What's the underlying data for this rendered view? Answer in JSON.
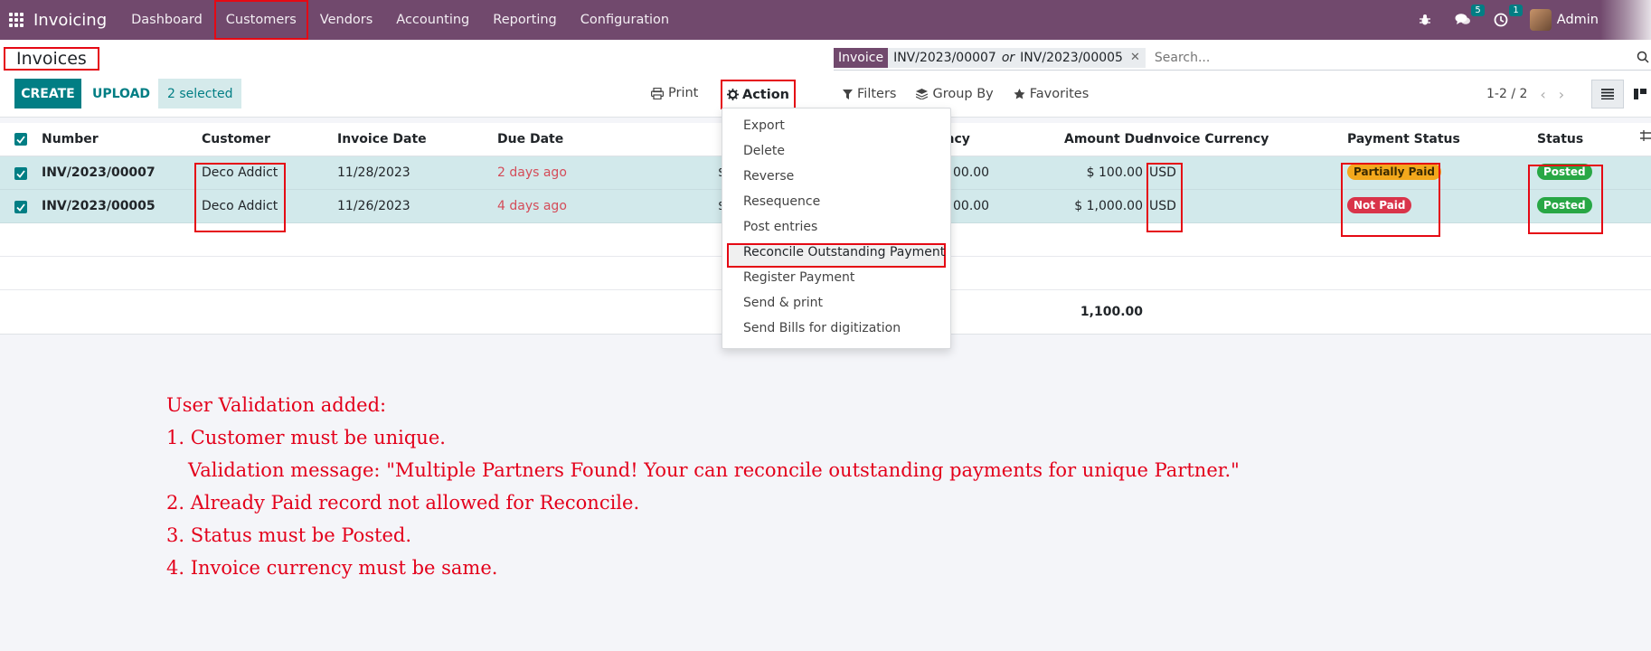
{
  "navbar": {
    "app_name": "Invoicing",
    "menu": [
      "Dashboard",
      "Customers",
      "Vendors",
      "Accounting",
      "Reporting",
      "Configuration"
    ],
    "highlighted_menu": "Customers",
    "messages_count": "5",
    "activities_count": "1",
    "user_name": "Admin",
    "bg_color": "#71496d"
  },
  "control_panel": {
    "title": "Invoices",
    "create_label": "CREATE",
    "upload_label": "UPLOAD",
    "selected_label": "2 selected",
    "print_label": "Print",
    "action_label": "Action",
    "search": {
      "facet_label": "Invoice",
      "facet_value_1": "INV/2023/00007",
      "facet_or": "or",
      "facet_value_2": "INV/2023/00005",
      "placeholder": "Search..."
    },
    "filters_label": "Filters",
    "group_by_label": "Group By",
    "favorites_label": "Favorites",
    "pager": "1-2 / 2"
  },
  "table": {
    "columns": {
      "number": "Number",
      "customer": "Customer",
      "invoice_date": "Invoice Date",
      "due_date": "Due Date",
      "currency_partial": "ency",
      "amount_due": "Amount Due",
      "invoice_currency": "Invoice Currency",
      "payment_status": "Payment Status",
      "status": "Status"
    },
    "rows": [
      {
        "number": "INV/2023/00007",
        "customer": "Deco Addict",
        "invoice_date": "11/28/2023",
        "due_date": "2 days ago",
        "total_partial": "$",
        "tax_excl_partial": "00.00",
        "amount_due": "$ 100.00",
        "currency": "USD",
        "payment_status": "Partially Paid",
        "status": "Posted"
      },
      {
        "number": "INV/2023/00005",
        "customer": "Deco Addict",
        "invoice_date": "11/26/2023",
        "due_date": "4 days ago",
        "total_partial": "$",
        "tax_excl_partial": "00.00",
        "amount_due": "$ 1,000.00",
        "currency": "USD",
        "payment_status": "Not Paid",
        "status": "Posted"
      }
    ],
    "total_amount_due": "1,100.00"
  },
  "action_menu": {
    "items": [
      "Export",
      "Delete",
      "Reverse",
      "Resequence",
      "Post entries",
      "Reconcile Outstanding Payment",
      "Register Payment",
      "Send & print",
      "Send Bills for digitization"
    ],
    "highlighted": "Reconcile Outstanding Payment"
  },
  "notes": {
    "heading": "User Validation added:",
    "line1": "1. Customer must be unique.",
    "line1_detail": "Validation message: \"Multiple Partners Found! Your can reconcile outstanding payments for unique Partner.\"",
    "line2": "2. Already Paid record not allowed for Reconcile.",
    "line3": "3. Status must be Posted.",
    "line4": "4. Invoice currency must be same."
  },
  "colors": {
    "brand": "#71496d",
    "primary": "#017e84",
    "selected_row": "#d2e9eb",
    "annotation_red": "#e50914",
    "partially_paid": "#f3a81c",
    "not_paid": "#d9344a",
    "posted": "#28a745"
  }
}
